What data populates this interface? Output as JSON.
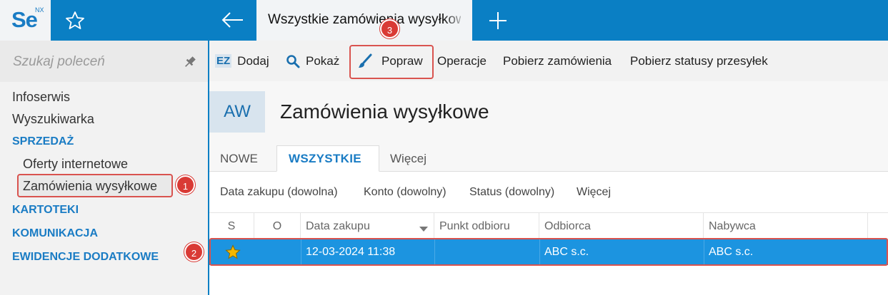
{
  "app": {
    "logo": "Se",
    "logo_suffix": "NX",
    "active_tab": "Wszystkie zamówienia wysyłkowe"
  },
  "sidebar": {
    "search_placeholder": "Szukaj poleceń",
    "items": [
      {
        "label": "Infoserwis"
      },
      {
        "label": "Wyszukiwarka"
      },
      {
        "label": "SPRZEDAŻ"
      },
      {
        "label": "Oferty internetowe"
      },
      {
        "label": "Zamówienia wysyłkowe"
      },
      {
        "label": "KARTOTEKI"
      },
      {
        "label": "KOMUNIKACJA"
      },
      {
        "label": "EWIDENCJE DODATKOWE"
      }
    ]
  },
  "toolbar": {
    "dodaj": "Dodaj",
    "dodaj_icon": "EZ",
    "pokaz": "Pokaż",
    "popraw": "Popraw",
    "operacje": "Operacje",
    "pobierz_zamowienia": "Pobierz zamówienia",
    "pobierz_statusy": "Pobierz statusy przesyłek"
  },
  "header": {
    "badge": "AW",
    "title": "Zamówienia wysyłkowe"
  },
  "tabs": [
    "NOWE",
    "WSZYSTKIE",
    "Więcej"
  ],
  "filters": [
    "Data zakupu (dowolna)",
    "Konto (dowolny)",
    "Status (dowolny)",
    "Więcej"
  ],
  "grid": {
    "columns": [
      "S",
      "O",
      "Data zakupu",
      "Punkt odbioru",
      "Odbiorca",
      "Nabywca"
    ],
    "rows": [
      {
        "data_zakupu": "12-03-2024 11:38",
        "punkt_odbioru": "",
        "odbiorca": "ABC s.c.",
        "nabywca": "ABC s.c."
      }
    ]
  },
  "callouts": [
    "1",
    "2",
    "3"
  ],
  "colors": {
    "accent": "#0a7fc4",
    "selected_row": "#1c94e0",
    "callout": "#d93a35",
    "star": "#f5b800"
  },
  "icons": [
    "star-icon",
    "back-arrow-icon",
    "plus-icon",
    "pin-icon",
    "search-icon",
    "brush-icon"
  ]
}
